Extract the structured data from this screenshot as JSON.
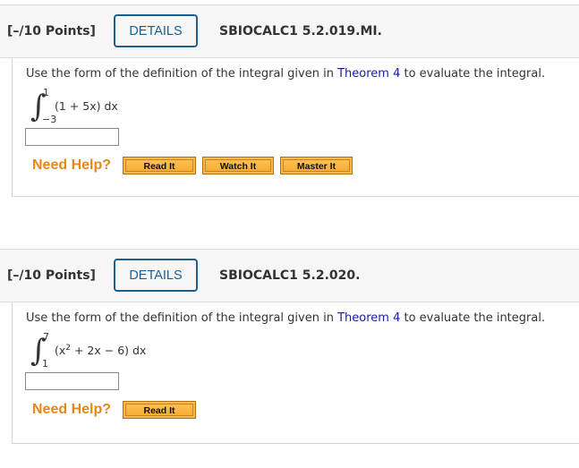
{
  "questions": [
    {
      "points": "[–/10 Points]",
      "details_label": "DETAILS",
      "code": "SBIOCALC1 5.2.019.MI.",
      "prompt_before": "Use the form of the definition of the integral given in ",
      "prompt_link": "Theorem 4",
      "prompt_after": " to evaluate the integral.",
      "integral": {
        "upper": "1",
        "lower": "−3",
        "integrand": "(1 + 5x) dx"
      },
      "answer_value": "",
      "need_help_label": "Need Help?",
      "help_buttons": [
        "Read It",
        "Watch It",
        "Master It"
      ]
    },
    {
      "points": "[–/10 Points]",
      "details_label": "DETAILS",
      "code": "SBIOCALC1 5.2.020.",
      "prompt_before": "Use the form of the definition of the integral given in ",
      "prompt_link": "Theorem 4",
      "prompt_after": " to evaluate the integral.",
      "integral": {
        "upper": "7",
        "lower": "1",
        "integrand_parts": [
          "(x",
          "2",
          " + 2x − 6) dx"
        ]
      },
      "answer_value": "",
      "need_help_label": "Need Help?",
      "help_buttons": [
        "Read It"
      ]
    }
  ]
}
